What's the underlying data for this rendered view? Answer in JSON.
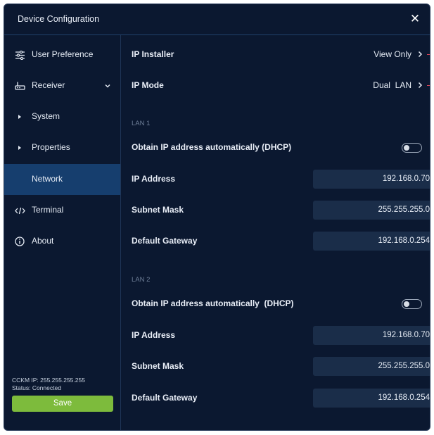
{
  "window": {
    "title": "Device Configuration"
  },
  "sidebar": {
    "items": [
      {
        "label": "User Preference",
        "icon": "sliders-icon"
      },
      {
        "label": "Receiver",
        "icon": "router-icon"
      },
      {
        "label": "System",
        "icon": "caret-right-icon"
      },
      {
        "label": "Properties",
        "icon": "caret-right-icon"
      },
      {
        "label": "Network",
        "icon": ""
      },
      {
        "label": "Terminal",
        "icon": "code-icon"
      },
      {
        "label": "About",
        "icon": "info-icon"
      }
    ],
    "active": "Network",
    "cckm_ip": "CCKM IP:  255.255.255.255",
    "status": "Status: Connected",
    "save_label": "Save"
  },
  "main": {
    "ip_installer": {
      "label": "IP Installer",
      "value": "View Only"
    },
    "ip_mode": {
      "label": "IP Mode",
      "value": "Dual  LAN"
    },
    "lan1": {
      "section": "LAN 1",
      "dhcp_label": "Obtain IP address automatically (DHCP)",
      "dhcp_on": false,
      "ip_label": "IP Address",
      "ip_value": "192.168.0.70",
      "subnet_label": "Subnet Mask",
      "subnet_value": "255.255.255.0",
      "gateway_label": "Default Gateway",
      "gateway_value": "192.168.0.254"
    },
    "lan2": {
      "section": "LAN 2",
      "dhcp_label": "Obtain IP address automatically  (DHCP)",
      "dhcp_on": false,
      "ip_label": "IP Address",
      "ip_value": "192.168.0.70",
      "subnet_label": "Subnet Mask",
      "subnet_value": "255.255.255.0",
      "gateway_label": "Default Gateway",
      "gateway_value": "192.168.0.254"
    }
  },
  "colors": {
    "background": "#0b1830",
    "active_nav": "#163e6e",
    "field": "#1a2d49",
    "save": "#7dbb3c"
  }
}
